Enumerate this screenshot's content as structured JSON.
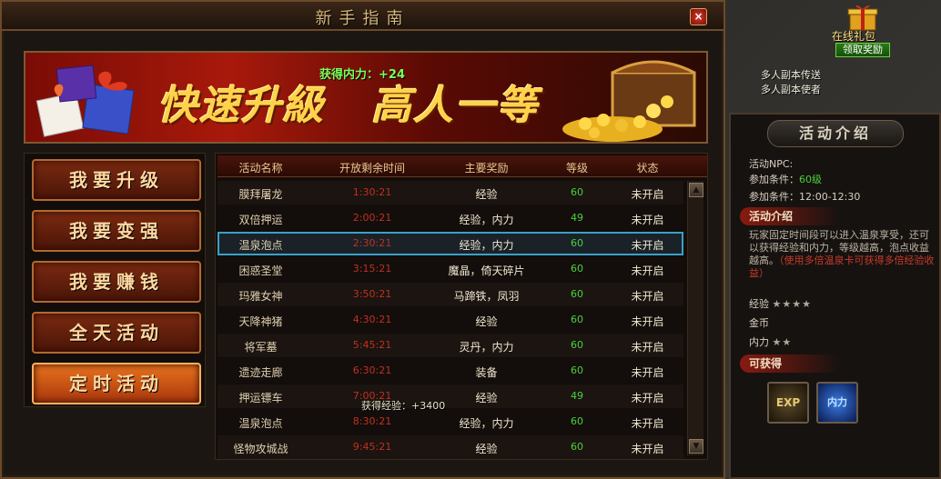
{
  "window": {
    "title": "新手指南",
    "close": "×"
  },
  "banner": {
    "slogan_left": "快速升級",
    "slogan_right": "高人一等",
    "gain_text": "获得内力：+24"
  },
  "menu": [
    {
      "label": "我要升级",
      "active": false
    },
    {
      "label": "我要变强",
      "active": false
    },
    {
      "label": "我要赚钱",
      "active": false
    },
    {
      "label": "全天活动",
      "active": false
    },
    {
      "label": "定时活动",
      "active": true
    }
  ],
  "table": {
    "headers": [
      "活动名称",
      "开放剩余时间",
      "主要奖励",
      "等级",
      "状态"
    ],
    "rows": [
      {
        "name": "膜拜屠龙",
        "time": "1:30:21",
        "reward": "经验",
        "level": "60",
        "status": "未开启"
      },
      {
        "name": "双倍押运",
        "time": "2:00:21",
        "reward": "经验，内力",
        "level": "49",
        "status": "未开启"
      },
      {
        "name": "温泉泡点",
        "time": "2:30:21",
        "reward": "经验，内力",
        "level": "60",
        "status": "未开启"
      },
      {
        "name": "困惑圣堂",
        "time": "3:15:21",
        "reward": "魔晶，倚天碎片",
        "level": "60",
        "status": "未开启"
      },
      {
        "name": "玛雅女神",
        "time": "3:50:21",
        "reward": "马蹄铁，凤羽",
        "level": "60",
        "status": "未开启"
      },
      {
        "name": "天降神猪",
        "time": "4:30:21",
        "reward": "经验",
        "level": "60",
        "status": "未开启"
      },
      {
        "name": "将军墓",
        "time": "5:45:21",
        "reward": "灵丹，内力",
        "level": "60",
        "status": "未开启"
      },
      {
        "name": "遗迹走廊",
        "time": "6:30:21",
        "reward": "装备",
        "level": "60",
        "status": "未开启"
      },
      {
        "name": "押运镖车",
        "time": "7:00:21",
        "reward": "经验",
        "level": "49",
        "status": "未开启"
      },
      {
        "name": "温泉泡点",
        "time": "8:30:21",
        "reward": "经验，内力",
        "level": "60",
        "status": "未开启"
      },
      {
        "name": "怪物攻城战",
        "time": "9:45:21",
        "reward": "经验",
        "level": "60",
        "status": "未开启"
      }
    ],
    "selected_index": 2,
    "float_text": "获得经验：+3400"
  },
  "side": {
    "title": "活动介绍",
    "npc_label": "活动NPC:",
    "cond1_label": "参加条件：",
    "cond1_value": "60级",
    "cond2_label": "参加条件：",
    "cond2_value": "12:00-12:30",
    "intro_heading": "活动介绍",
    "desc_main": "玩家固定时间段可以进入温泉享受，还可以获得经验和内力，等级越高，泡点收益越高。",
    "desc_red": "（使用多倍温泉卡可获得多倍经验收益）",
    "stat_exp": "经验",
    "stat_exp_stars": "★★★★",
    "stat_gold": "金币",
    "stat_gold_stars": "",
    "stat_power": "内力",
    "stat_power_stars": "★★",
    "obtain_heading": "可获得",
    "reward1": "EXP",
    "reward2": "内力"
  },
  "top_right": {
    "gift_label": "在线礼包",
    "gift_claim": "领取奖励",
    "link1": "多人副本传送",
    "link2": "多人副本使者"
  }
}
